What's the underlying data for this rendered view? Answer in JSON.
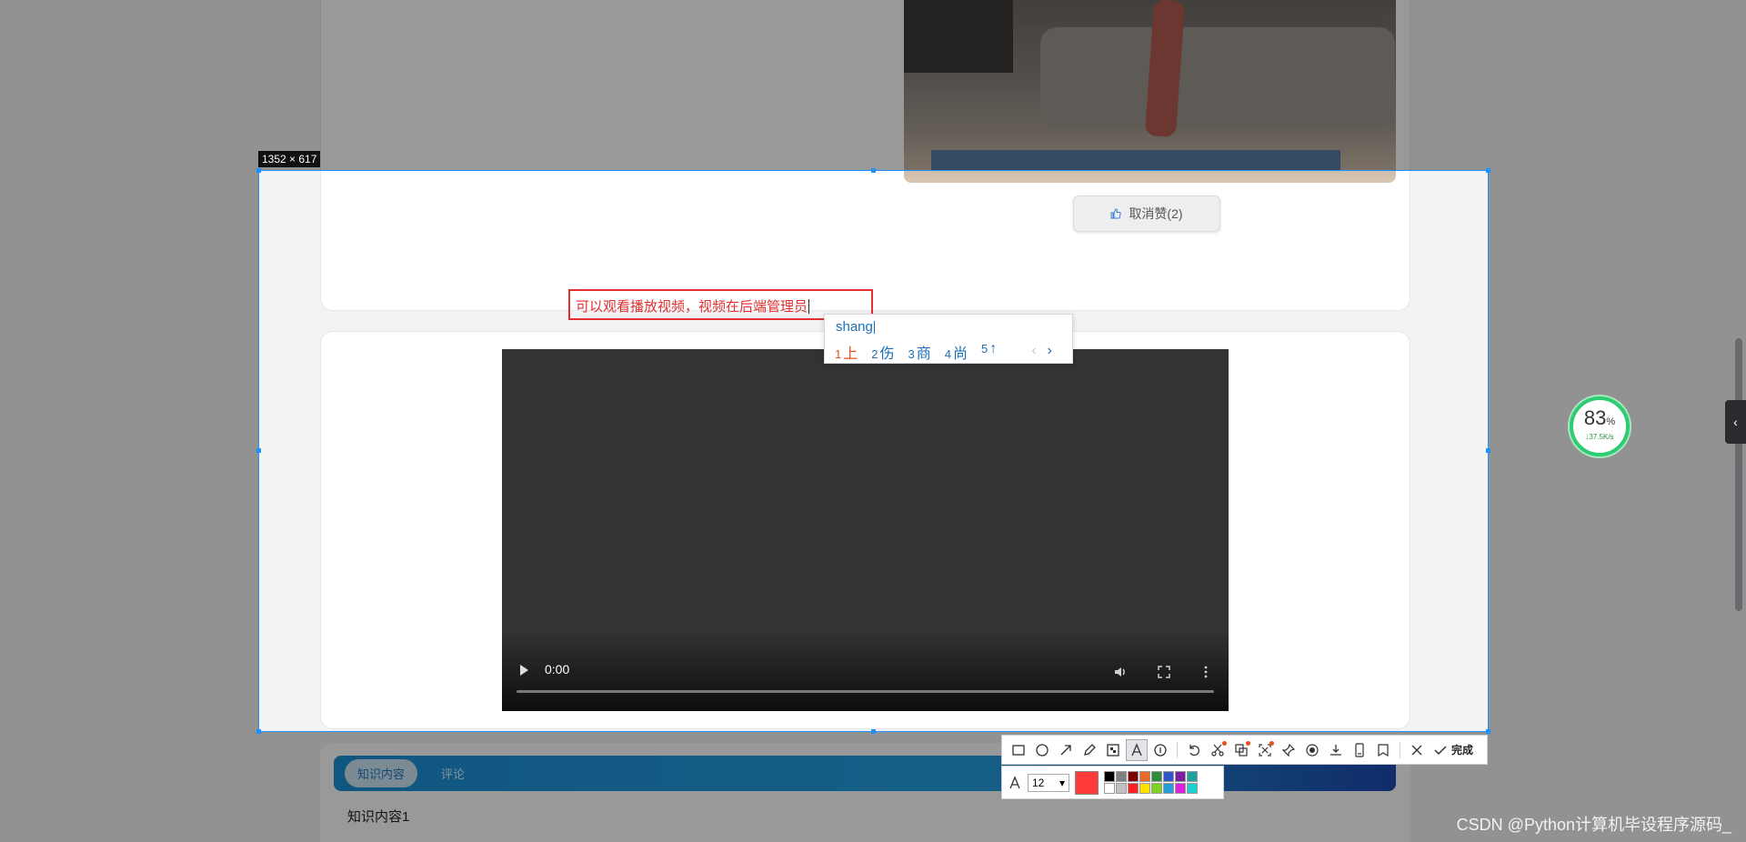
{
  "selection": {
    "size_label": "1352 × 617"
  },
  "like_button": {
    "label": "取消赞(2)"
  },
  "annotation": {
    "text": "可以观看播放视频，视频在后端管理员"
  },
  "ime": {
    "pinyin": "shang",
    "candidates": [
      {
        "n": "1",
        "text": "上"
      },
      {
        "n": "2",
        "text": "伤"
      },
      {
        "n": "3",
        "text": "商"
      },
      {
        "n": "4",
        "text": "尚"
      },
      {
        "n": "5",
        "text": "↑"
      }
    ],
    "prev": "‹",
    "next": "›"
  },
  "video": {
    "time": "0:00"
  },
  "tabs": [
    {
      "label": "知识内容"
    },
    {
      "label": "评论"
    }
  ],
  "content_title": "知识内容1",
  "speed_widget": {
    "percent": "83",
    "percent_unit": "%",
    "rate": "↓37.5K/s"
  },
  "side_tab": {
    "arrow": "‹"
  },
  "toolbar": {
    "done_label": "完成",
    "icons": [
      "rectangle-icon",
      "ellipse-icon",
      "arrow-icon",
      "pencil-icon",
      "mosaic-icon",
      "text-icon",
      "number-icon",
      "undo-icon",
      "translate-icon",
      "ocr-icon",
      "screen-record-icon",
      "pin-icon",
      "record-icon",
      "download-icon",
      "long-screenshot-icon",
      "save-icon",
      "close-icon",
      "check-icon"
    ]
  },
  "text_options": {
    "font_size": "12",
    "current_color": "#ff3b3b",
    "palette": [
      "#000000",
      "#808080",
      "#800000",
      "#e86a2a",
      "#2e8b3a",
      "#3355cc",
      "#7a1fa2",
      "#20a0a0",
      "#ffffff",
      "#c0c0c0",
      "#ff2020",
      "#ffe000",
      "#7fd320",
      "#2a9dd8",
      "#e020e0",
      "#20d0d0"
    ]
  },
  "watermark": "CSDN @Python计算机毕设程序源码_"
}
